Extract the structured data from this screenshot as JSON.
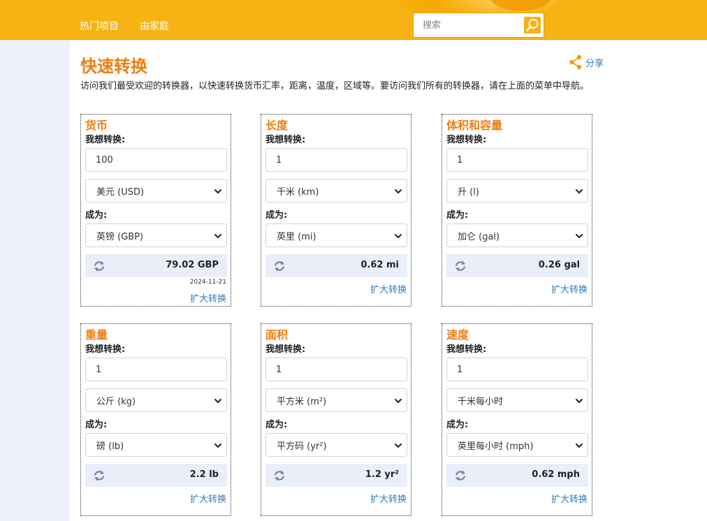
{
  "nav": {
    "items": [
      "热门项目",
      "由家庭"
    ],
    "search_placeholder": "搜索"
  },
  "page": {
    "title": "快速转换",
    "share_label": "分享",
    "intro": "访问我们最受欢迎的转换器，以快速转换货币汇率，距离，温度，区域等。要访问我们所有的转换器，请在上面的菜单中导航。"
  },
  "labels": {
    "from": "我想转换:",
    "to": "成为:",
    "expand": "扩大转换"
  },
  "converters": [
    {
      "title": "货币",
      "input": "100",
      "from_unit": "美元 (USD)",
      "to_unit": "英镑 (GBP)",
      "result": "79.02 GBP",
      "date": "2024-11-21"
    },
    {
      "title": "长度",
      "input": "1",
      "from_unit": "千米 (km)",
      "to_unit": "英里 (mi)",
      "result": "0.62 mi"
    },
    {
      "title": "体积和容量",
      "input": "1",
      "from_unit": "升 (l)",
      "to_unit": "加仑 (gal)",
      "result": "0.26 gal"
    },
    {
      "title": "重量",
      "input": "1",
      "from_unit": "公斤 (kg)",
      "to_unit": "磅 (lb)",
      "result": "2.2 lb"
    },
    {
      "title": "面积",
      "input": "1",
      "from_unit": "平方米 (m²)",
      "to_unit": "平方码 (yr²)",
      "result": "1.2 yr²"
    },
    {
      "title": "速度",
      "input": "1",
      "from_unit": "千米每小时",
      "to_unit": "英里每小时 (mph)",
      "result": "0.62 mph"
    }
  ],
  "colors": {
    "topbar": "#f7b213",
    "accent_orange": "#f07d12",
    "link_blue": "#2f79bd",
    "result_bg": "#e9eef9"
  },
  "icons": {
    "search": "search-icon",
    "share": "share-icon",
    "swap": "swap-icon",
    "dropdown": "chevron-down-icon"
  }
}
